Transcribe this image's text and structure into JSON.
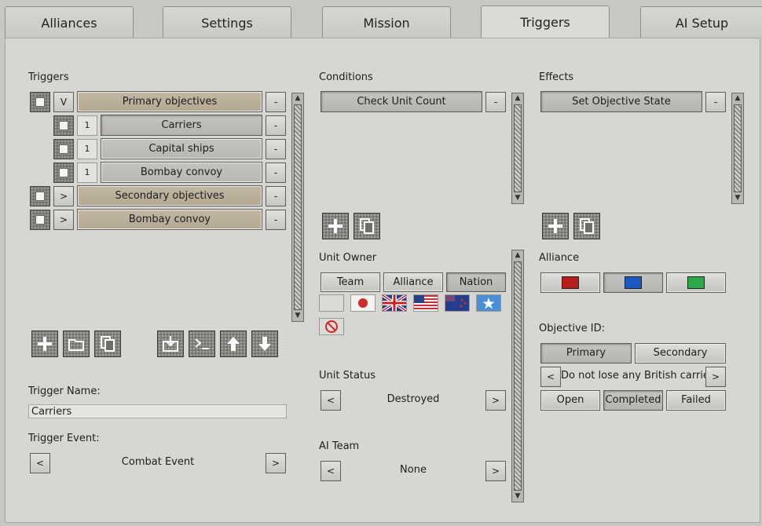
{
  "tabs": [
    {
      "label": "Alliances"
    },
    {
      "label": "Settings"
    },
    {
      "label": "Mission"
    },
    {
      "label": "Triggers"
    },
    {
      "label": "AI Setup"
    }
  ],
  "triggers": {
    "heading": "Triggers",
    "items": [
      {
        "label": "Primary objectives",
        "toggle": "V",
        "remove": "-"
      },
      {
        "label": "Carriers",
        "index": "1",
        "remove": "-"
      },
      {
        "label": "Capital ships",
        "index": "1",
        "remove": "-"
      },
      {
        "label": "Bombay convoy",
        "index": "1",
        "remove": "-"
      },
      {
        "label": "Secondary objectives",
        "toggle": ">",
        "remove": "-"
      },
      {
        "label": "Bombay convoy",
        "toggle": ">",
        "remove": "-"
      }
    ],
    "toolbar_icons": [
      "add-icon",
      "folder-icon",
      "copy-icon",
      "import-icon",
      "console-icon",
      "move-up-icon",
      "move-down-icon"
    ],
    "name_label": "Trigger Name:",
    "name_value": "Carriers",
    "event_label": "Trigger Event:",
    "event_value": "Combat Event",
    "prev": "<",
    "next": ">"
  },
  "conditions": {
    "heading": "Conditions",
    "items": [
      {
        "label": "Check Unit Count",
        "remove": "-"
      }
    ],
    "unit_owner_label": "Unit Owner",
    "owner_tabs": [
      "Team",
      "Alliance",
      "Nation"
    ],
    "flags": [
      "blank",
      "japan",
      "united-kingdom",
      "united-states",
      "new-zealand",
      "somalia",
      "none"
    ],
    "unit_status_label": "Unit Status",
    "unit_status_value": "Destroyed",
    "ai_team_label": "AI Team",
    "ai_team_value": "None",
    "prev": "<",
    "next": ">"
  },
  "effects": {
    "heading": "Effects",
    "items": [
      {
        "label": "Set Objective State",
        "remove": "-"
      }
    ],
    "alliance_label": "Alliance",
    "alliance_colors": [
      "#b81c1c",
      "#1c58c0",
      "#2aa84a"
    ],
    "objective_label": "Objective ID:",
    "objective_tabs": [
      "Primary",
      "Secondary"
    ],
    "objective_value": "Do not lose any British carriers",
    "state_buttons": [
      "Open",
      "Completed",
      "Failed"
    ],
    "prev": "<",
    "next": ">"
  }
}
